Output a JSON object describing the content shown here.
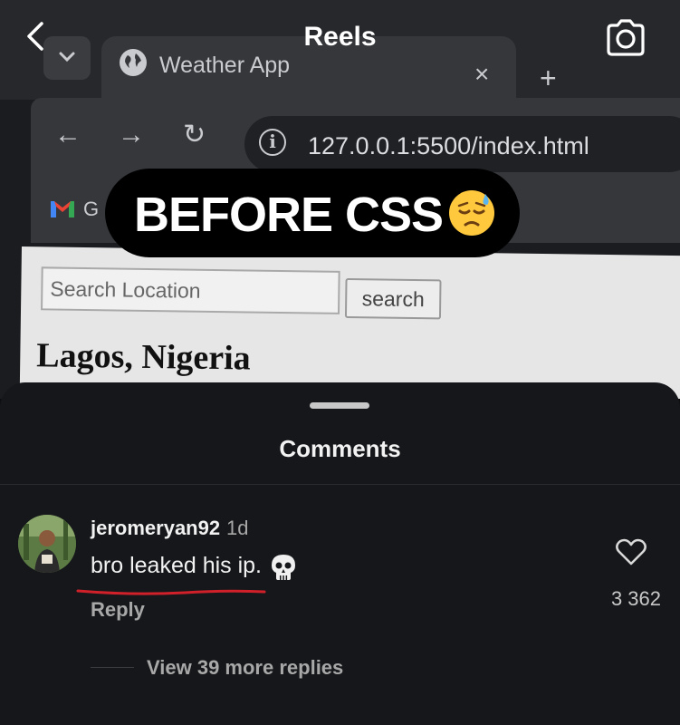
{
  "header": {
    "title": "Reels"
  },
  "browser": {
    "tab_title": "Weather App",
    "close_symbol": "×",
    "new_tab_symbol": "+",
    "url": "127.0.0.1:5500/index.html",
    "nav": {
      "back": "←",
      "forward": "→",
      "reload": "↻"
    },
    "bookmark_letter": "G"
  },
  "webpage": {
    "search_placeholder": "Search Location",
    "search_button": "search",
    "city": "Lagos, Nigeria"
  },
  "caption": {
    "text": "BEFORE CSS",
    "emoji": "downcast-face-with-sweat"
  },
  "comments": {
    "title": "Comments",
    "items": [
      {
        "username": "jeromeryan92",
        "time": "1d",
        "text": "bro leaked his ip.",
        "emoji": "skull",
        "reply_label": "Reply",
        "likes": "3 362",
        "view_replies": "View 39 more replies"
      }
    ]
  },
  "colors": {
    "sheet_bg": "#15171a",
    "underline": "#d0202a",
    "caption_bg": "#000000"
  }
}
